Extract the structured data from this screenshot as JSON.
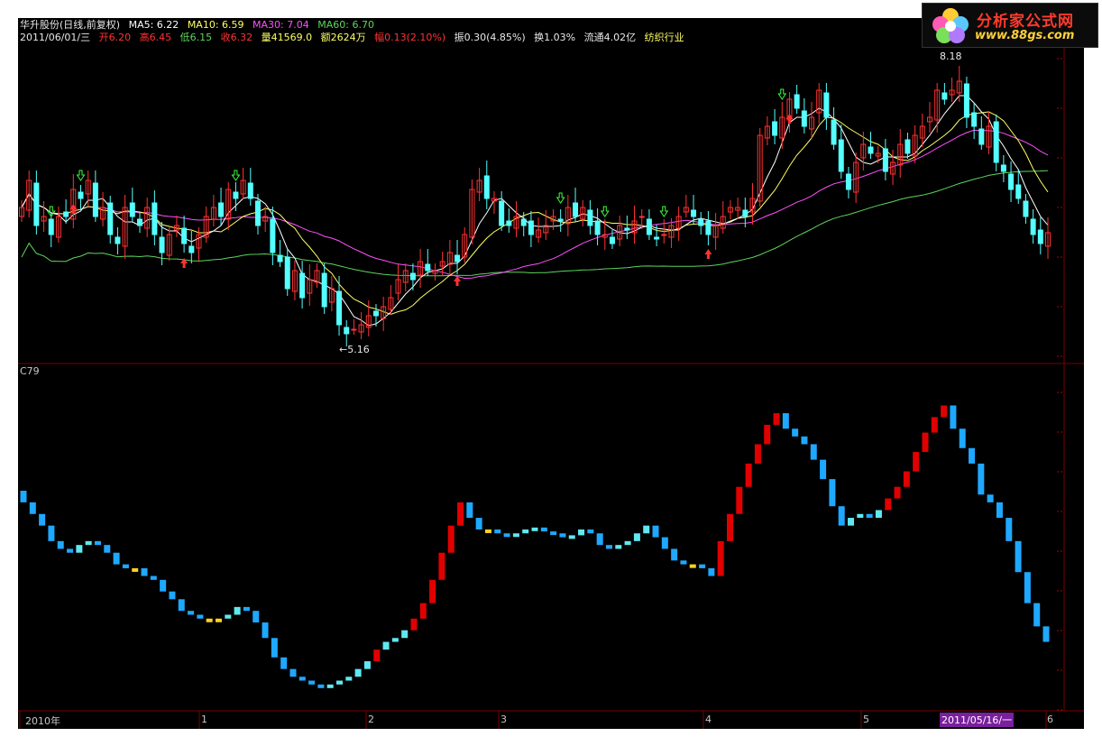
{
  "header": {
    "stock": "华升股份(日线,前复权)",
    "ma5": "MA5: 6.22",
    "ma10": "MA10: 6.59",
    "ma30": "MA30: 7.04",
    "ma60": "MA60: 6.70",
    "date": "2011/06/01/三",
    "open": "开6.20",
    "high": "高6.45",
    "low": "低6.15",
    "close": "收6.32",
    "volume": "量41569.0",
    "amount": "额2624万",
    "change": "幅0.13(2.10%)",
    "amplitude": "振0.30(4.85%)",
    "turnover": "换1.03%",
    "float": "流通4.02亿",
    "industry": "纺织行业"
  },
  "logo": {
    "brand": "分析家公式网",
    "url": "www.88gs.com"
  },
  "indicator_label": "C79",
  "price_labels": {
    "high": "8.18",
    "low": "5.16"
  },
  "date_axis": {
    "year_label": "2010年",
    "months": [
      "1",
      "2",
      "3",
      "4",
      "5",
      "6"
    ],
    "cursor_date": "2011/05/16/一"
  },
  "colors": {
    "background": "#000000",
    "up": "#ff3232",
    "down": "#54ffff",
    "ma5": "#ffffff",
    "ma10": "#ffff64",
    "ma30": "#ff50ff",
    "ma60": "#5cd65c",
    "grid": "#7a0000",
    "ind_red": "#e00000",
    "ind_cyan": "#5fe8f0",
    "ind_blue": "#1ea8ff",
    "ind_yellow": "#ffd21e"
  },
  "chart_data": [
    {
      "type": "candlestick",
      "title": "华升股份(日线,前复权)",
      "price_range": [
        4.9,
        8.4
      ],
      "series_close": [
        6.6,
        6.9,
        6.4,
        6.5,
        6.3,
        6.5,
        6.5,
        6.8,
        6.7,
        6.9,
        6.5,
        6.6,
        6.3,
        6.2,
        6.6,
        6.5,
        6.4,
        6.6,
        6.3,
        6.1,
        6.3,
        6.4,
        6.2,
        6.1,
        6.3,
        6.5,
        6.6,
        6.5,
        6.8,
        6.7,
        6.9,
        6.7,
        6.4,
        6.5,
        6.1,
        6.0,
        5.7,
        5.9,
        5.6,
        5.8,
        5.9,
        5.5,
        5.7,
        5.3,
        5.2,
        5.25,
        5.3,
        5.4,
        5.4,
        5.5,
        5.6,
        5.8,
        5.9,
        5.8,
        6.0,
        5.9,
        5.9,
        6.0,
        6.1,
        6.0,
        6.3,
        6.8,
        6.9,
        6.7,
        6.7,
        6.4,
        6.4,
        6.5,
        6.4,
        6.3,
        6.35,
        6.4,
        6.5,
        6.45,
        6.6,
        6.5,
        6.6,
        6.4,
        6.3,
        6.3,
        6.2,
        6.4,
        6.35,
        6.45,
        6.5,
        6.3,
        6.25,
        6.3,
        6.4,
        6.5,
        6.6,
        6.5,
        6.4,
        6.3,
        6.4,
        6.5,
        6.6,
        6.6,
        6.5,
        6.7,
        7.4,
        7.5,
        7.4,
        7.6,
        7.8,
        7.7,
        7.5,
        7.6,
        7.9,
        7.6,
        7.3,
        7.0,
        6.8,
        7.1,
        7.3,
        7.2,
        7.2,
        7.0,
        7.1,
        7.3,
        7.2,
        7.4,
        7.5,
        7.6,
        7.9,
        7.8,
        7.9,
        8.0,
        7.6,
        7.5,
        7.3,
        7.5,
        7.1,
        7.0,
        6.8,
        6.7,
        6.5,
        6.3,
        6.2,
        6.32
      ],
      "ma_lines": [
        "MA5",
        "MA10",
        "MA30",
        "MA60"
      ]
    },
    {
      "type": "bar",
      "title": "C79",
      "values": [
        5.6,
        5.3,
        5.0,
        4.6,
        4.4,
        4.3,
        4.5,
        4.6,
        4.5,
        4.3,
        4.0,
        3.9,
        3.9,
        3.7,
        3.6,
        3.3,
        3.1,
        2.8,
        2.7,
        2.6,
        2.6,
        2.6,
        2.7,
        2.9,
        2.8,
        2.5,
        2.1,
        1.6,
        1.3,
        1.1,
        1.0,
        0.9,
        0.85,
        0.9,
        1.0,
        1.1,
        1.3,
        1.5,
        1.8,
        2.0,
        2.1,
        2.3,
        2.6,
        3.0,
        3.6,
        4.3,
        5.0,
        5.6,
        5.2,
        4.9,
        4.9,
        4.8,
        4.75,
        4.8,
        4.9,
        4.95,
        4.85,
        4.8,
        4.7,
        4.75,
        4.9,
        4.8,
        4.5,
        4.4,
        4.5,
        4.6,
        4.8,
        5.0,
        4.7,
        4.4,
        4.1,
        4.0,
        4.0,
        3.9,
        3.7,
        4.6,
        5.3,
        6.0,
        6.6,
        7.1,
        7.6,
        7.9,
        7.5,
        7.3,
        7.1,
        6.7,
        6.2,
        5.5,
        5.0,
        5.2,
        5.3,
        5.2,
        5.4,
        5.7,
        6.0,
        6.4,
        6.9,
        7.4,
        7.8,
        8.1,
        7.5,
        7.0,
        6.6,
        5.8,
        5.6,
        5.2,
        4.6,
        3.8,
        3.0,
        2.4,
        2.0
      ]
    }
  ]
}
